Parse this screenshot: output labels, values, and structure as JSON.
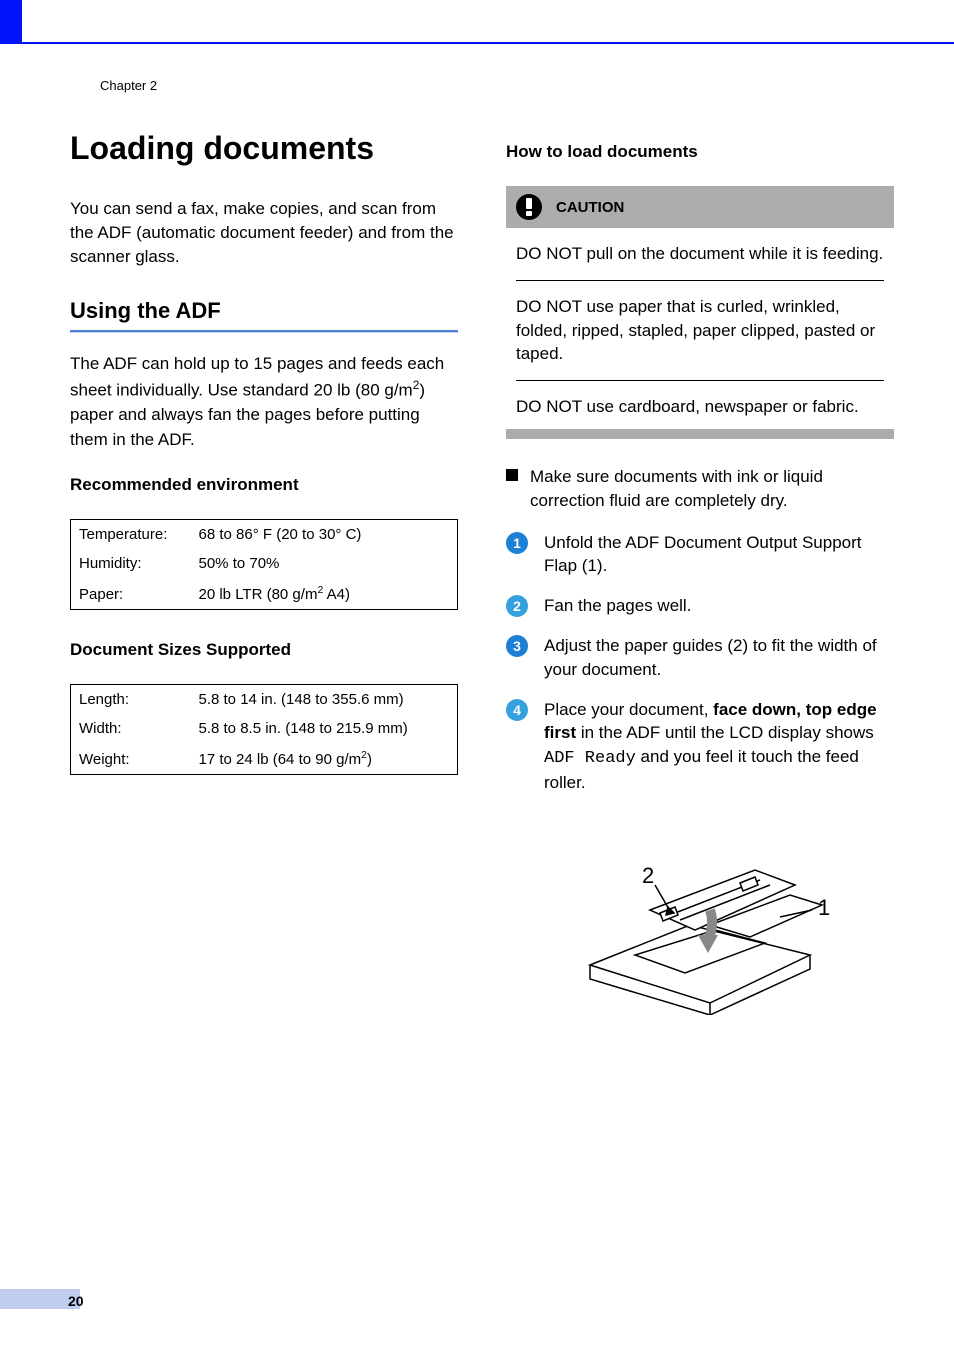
{
  "header": {
    "chapter": "Chapter 2"
  },
  "left": {
    "title": "Loading documents",
    "intro": "You can send a fax, make copies, and scan from the ADF (automatic document feeder) and from the scanner glass.",
    "h2": "Using the ADF",
    "adf_para_a": "The ADF can hold up to 15 pages and feeds each sheet individually. Use standard 20 lb (80 g/m",
    "adf_para_b": ") paper and always fan the pages before putting them in the ADF.",
    "env_h3": "Recommended environment",
    "env": {
      "temp_label": "Temperature:",
      "temp_value": "68 to 86° F (20 to 30° C)",
      "hum_label": "Humidity:",
      "hum_value": "50% to 70%",
      "paper_label": "Paper:",
      "paper_value_a": "20 lb LTR (80 g/m",
      "paper_value_b": "  A4)"
    },
    "sizes_h3": "Document Sizes Supported",
    "sizes": {
      "length_label": "Length:",
      "length_value": "5.8 to 14 in. (148 to 355.6 mm)",
      "width_label": "Width:",
      "width_value": "5.8 to 8.5 in. (148 to 215.9 mm)",
      "weight_label": "Weight:",
      "weight_value_a": "17 to 24 lb (64 to 90 g/m",
      "weight_value_b": ")"
    }
  },
  "right": {
    "h3": "How to load documents",
    "caution_label": "CAUTION",
    "caution": {
      "c1": "DO NOT pull on the document while it is feeding.",
      "c2": "DO NOT use paper that is curled, wrinkled, folded, ripped, stapled, paper clipped, pasted or taped.",
      "c3": "DO NOT use cardboard, newspaper or fabric."
    },
    "bullet": "Make sure documents with ink or liquid correction fluid are completely dry.",
    "steps": {
      "s1_num": "1",
      "s1": "Unfold the ADF Document Output Support Flap (1).",
      "s2_num": "2",
      "s2": "Fan the pages well.",
      "s3_num": "3",
      "s3": "Adjust the paper guides (2) to fit the width of your document.",
      "s4_num": "4",
      "s4a": "Place your document, ",
      "s4b": "face down, top edge first",
      "s4c": " in the ADF until the LCD display shows ",
      "s4d": "ADF Ready",
      "s4e": " and you feel it touch the feed roller."
    },
    "step_colors": {
      "s1": "#1b80d6",
      "s2": "#33a1dd",
      "s3": "#1b80d6",
      "s4": "#33a1dd"
    },
    "illus": {
      "label1": "1",
      "label2": "2"
    }
  },
  "footer": {
    "page": "20"
  }
}
